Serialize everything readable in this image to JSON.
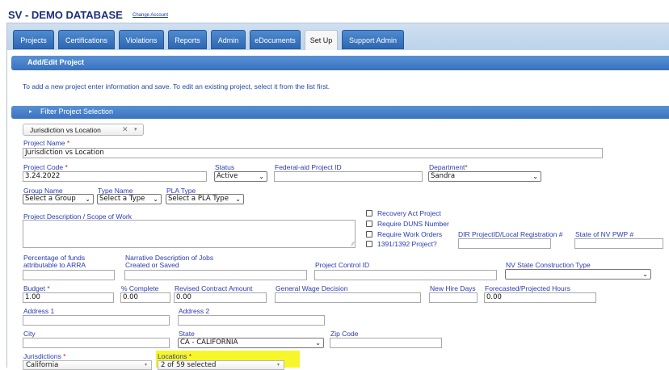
{
  "app": {
    "title": "SV - DEMO DATABASE",
    "change_account": "Change Account"
  },
  "tabs": [
    {
      "label": "Projects",
      "active": false
    },
    {
      "label": "Certifications",
      "active": false
    },
    {
      "label": "Violations",
      "active": false
    },
    {
      "label": "Reports",
      "active": false
    },
    {
      "label": "Admin",
      "active": false
    },
    {
      "label": "eDocuments",
      "active": false
    },
    {
      "label": "Set Up",
      "active": true
    },
    {
      "label": "Support Admin",
      "active": false
    }
  ],
  "section": {
    "header": "Add/Edit Project",
    "instructions": "To add a new project enter information and save. To edit an existing project, select it from the list first.",
    "filter_label": "Filter Project Selection",
    "filter_arrow_icon": "chevron-right-icon"
  },
  "project_selector": {
    "value": "Jurisdiction vs Location",
    "clear_icon": "close-icon",
    "dropdown_icon": "chevron-down-icon"
  },
  "form": {
    "project_name": {
      "label": "Project Name",
      "required": "*",
      "value": "Jurisdiction vs Location"
    },
    "project_code": {
      "label": "Project Code",
      "required": "*",
      "value": "3.24.2022"
    },
    "status": {
      "label": "Status",
      "value": "Active"
    },
    "federal_aid_id": {
      "label": "Federal-aid Project ID",
      "value": ""
    },
    "department": {
      "label": "Department",
      "required": "*",
      "value": "Sandra"
    },
    "group_name": {
      "label": "Group Name",
      "value": "Select a Group"
    },
    "type_name": {
      "label": "Type Name",
      "value": "Select a Type"
    },
    "pla_type": {
      "label": "PLA Type",
      "value": "Select a PLA Type"
    },
    "description": {
      "label": "Project Description / Scope of Work",
      "value": ""
    },
    "checkboxes": [
      {
        "label": "Recovery Act Project",
        "checked": false
      },
      {
        "label": "Require DUNS Number",
        "checked": false
      },
      {
        "label": "Require Work Orders",
        "checked": false
      },
      {
        "label": "1391/1392 Project?",
        "checked": false
      }
    ],
    "dir_project_id": {
      "label": "DIR ProjectID/Local Registration #",
      "value": ""
    },
    "state_nv_pwp": {
      "label": "State of NV PWP #",
      "value": ""
    },
    "pct_funds": {
      "label_line1": "Percentage of funds",
      "label_line2": "attributable to ARRA",
      "value": ""
    },
    "narrative": {
      "label_line1": "Narrative Description of Jobs",
      "label_line2": "Created or Saved",
      "value": ""
    },
    "project_control_id": {
      "label": "Project Control ID",
      "value": ""
    },
    "nv_construction_type": {
      "label": "NV State Construction Type",
      "value": ""
    },
    "budget": {
      "label": "Budget",
      "required": "*",
      "value": "1.00"
    },
    "pct_complete": {
      "label": "% Complete",
      "value": "0.00"
    },
    "revised_contract": {
      "label": "Revised Contract Amount",
      "value": "0.00"
    },
    "general_wage": {
      "label": "General Wage Decision",
      "value": ""
    },
    "new_hire_days": {
      "label": "New Hire Days",
      "value": ""
    },
    "forecasted_hours": {
      "label": "Forecasted/Projected Hours",
      "value": "0.00"
    },
    "address1": {
      "label": "Address 1",
      "value": ""
    },
    "address2": {
      "label": "Address 2",
      "value": ""
    },
    "city": {
      "label": "City",
      "value": ""
    },
    "state": {
      "label": "State",
      "value": "CA - CALIFORNIA"
    },
    "zip": {
      "label": "Zip Code",
      "value": ""
    },
    "jurisdictions": {
      "label": "Jurisdictions",
      "required": "*",
      "value": "California"
    },
    "locations": {
      "label": "Locations",
      "required": "*",
      "value": "2 of 59 selected"
    }
  },
  "colors": {
    "title": "#1c2f7a",
    "tab_blue": "#3a72bf",
    "label_blue": "#2a3bb0",
    "required_red": "#d01a1a",
    "highlight_yellow": "#f7f62a"
  }
}
